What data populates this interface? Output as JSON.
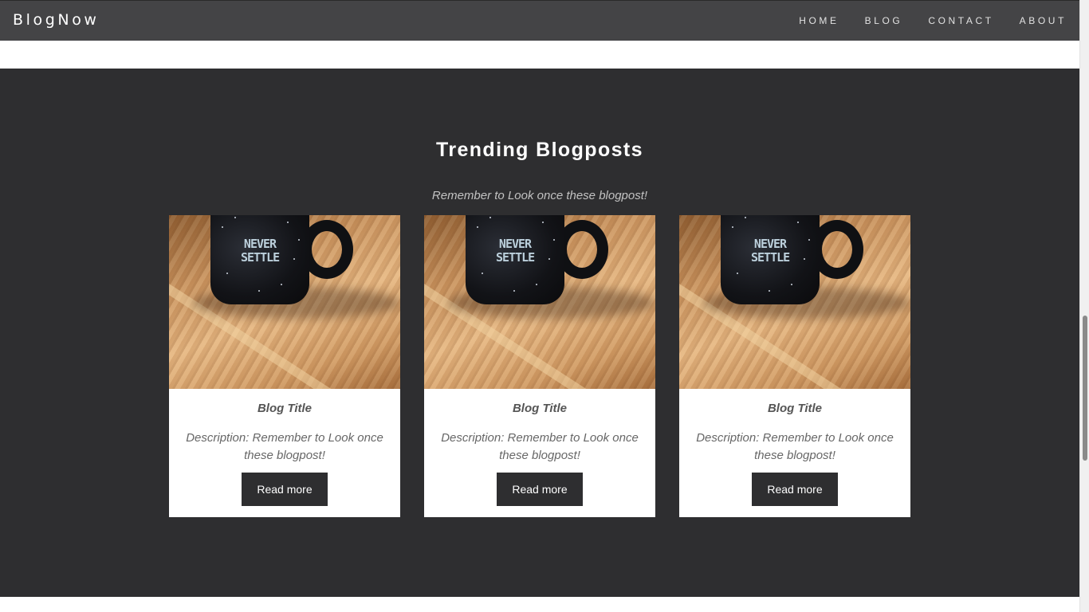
{
  "navbar": {
    "brand": "BlogNow",
    "links": [
      "HOME",
      "BLOG",
      "CONTACT",
      "ABOUT"
    ]
  },
  "trending": {
    "title": "Trending Blogposts",
    "subtitle": "Remember to Look once these blogpost!",
    "cards": [
      {
        "image_text": "NEVER SETTLE",
        "title": "Blog Title",
        "description": "Description: Remember to Look once these blogpost!",
        "button_label": "Read more"
      },
      {
        "image_text": "NEVER SETTLE",
        "title": "Blog Title",
        "description": "Description: Remember to Look once these blogpost!",
        "button_label": "Read more"
      },
      {
        "image_text": "NEVER SETTLE",
        "title": "Blog Title",
        "description": "Description: Remember to Look once these blogpost!",
        "button_label": "Read more"
      }
    ]
  },
  "colors": {
    "navbar_bg": "#444446",
    "section_bg": "#2e2e30",
    "button_bg": "#2e2e30",
    "card_bg": "#ffffff"
  }
}
